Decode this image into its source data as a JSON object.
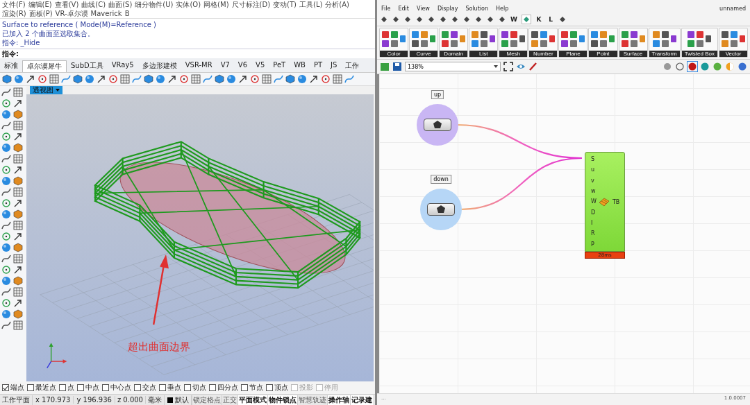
{
  "rhino": {
    "menu": [
      "文件(F)",
      "编辑(E)",
      "查看(V)",
      "曲线(C)",
      "曲面(S)",
      "细分物件(U)",
      "实体(O)",
      "网格(M)",
      "尺寸标注(D)",
      "变动(T)",
      "工具(L)",
      "分析(A)",
      "渲染(R)",
      "面板(P)",
      "VR-卓尔谟",
      "Maverick",
      "B"
    ],
    "command_history": [
      "Surface to reference ( Mode(M)=Reference )",
      "已加入 2 个曲面至选取集合。",
      "指令: _Hide"
    ],
    "command_prompt": "指令:",
    "tabs": [
      {
        "label": "标准",
        "selected": false
      },
      {
        "label": "卓尔谟犀牛",
        "selected": true
      },
      {
        "label": "SubD工具",
        "selected": false
      },
      {
        "label": "VRay5",
        "selected": false
      },
      {
        "label": "多边形建模",
        "selected": false
      },
      {
        "label": "VSR-MR",
        "selected": false
      },
      {
        "label": "V7",
        "selected": false
      },
      {
        "label": "V6",
        "selected": false
      },
      {
        "label": "V5",
        "selected": false
      },
      {
        "label": "PeT",
        "selected": false
      },
      {
        "label": "WB",
        "selected": false
      },
      {
        "label": "PT",
        "selected": false
      },
      {
        "label": "JS",
        "selected": false
      },
      {
        "label": "工作",
        "selected": false
      }
    ],
    "viewport": {
      "title": "透视图",
      "annotation": "超出曲面边界"
    },
    "osnaps": [
      {
        "label": "端点",
        "checked": true,
        "disabled": false
      },
      {
        "label": "最近点",
        "checked": false,
        "disabled": false
      },
      {
        "label": "点",
        "checked": false,
        "disabled": false
      },
      {
        "label": "中点",
        "checked": false,
        "disabled": false
      },
      {
        "label": "中心点",
        "checked": false,
        "disabled": false
      },
      {
        "label": "交点",
        "checked": false,
        "disabled": false
      },
      {
        "label": "垂点",
        "checked": false,
        "disabled": false
      },
      {
        "label": "切点",
        "checked": false,
        "disabled": false
      },
      {
        "label": "四分点",
        "checked": false,
        "disabled": false
      },
      {
        "label": "节点",
        "checked": false,
        "disabled": false
      },
      {
        "label": "顶点",
        "checked": false,
        "disabled": false
      },
      {
        "label": "投影",
        "checked": false,
        "disabled": true
      },
      {
        "label": "停用",
        "checked": false,
        "disabled": true
      }
    ],
    "status": {
      "cplane": "工作平面",
      "x": "x 170.973",
      "y": "y 196.936",
      "z": "z 0.000",
      "units": "毫米",
      "layer": "默认",
      "toggles": [
        {
          "label": "锁定格点",
          "on": false
        },
        {
          "label": "正交",
          "on": false
        },
        {
          "label": "平面模式",
          "on": true
        },
        {
          "label": "物件锁点",
          "on": true
        },
        {
          "label": "智慧轨迹",
          "on": false
        },
        {
          "label": "操作轴",
          "on": true
        },
        {
          "label": "记录建",
          "on": true
        }
      ]
    }
  },
  "grasshopper": {
    "menu": [
      "File",
      "Edit",
      "View",
      "Display",
      "Solution",
      "Help"
    ],
    "document": "unnamed",
    "tabs": [
      {
        "kind": "icon",
        "selected": false
      },
      {
        "kind": "icon",
        "selected": false
      },
      {
        "kind": "icon",
        "selected": false
      },
      {
        "kind": "icon",
        "selected": false
      },
      {
        "kind": "icon",
        "selected": false
      },
      {
        "kind": "icon",
        "selected": false
      },
      {
        "kind": "icon",
        "selected": false
      },
      {
        "kind": "icon",
        "selected": false
      },
      {
        "kind": "icon",
        "selected": false
      },
      {
        "kind": "icon",
        "selected": false
      },
      {
        "kind": "icon",
        "selected": false
      },
      {
        "kind": "letter",
        "label": "W",
        "selected": false
      },
      {
        "kind": "icon",
        "selected": true
      },
      {
        "kind": "letter",
        "label": "K",
        "selected": false
      },
      {
        "kind": "letter",
        "label": "L",
        "selected": false
      },
      {
        "kind": "icon",
        "selected": false
      }
    ],
    "ribbon_groups": [
      "Color",
      "Curve",
      "Domain",
      "List",
      "Mesh",
      "Number",
      "Plane",
      "Point",
      "Surface",
      "Transform",
      "Twisted Box",
      "Vector"
    ],
    "zoom": "138%",
    "canvas": {
      "params": [
        {
          "label": "up",
          "color": "#c9b6f4"
        },
        {
          "label": "down",
          "color": "#b6d6f6"
        }
      ],
      "component": {
        "inputs": [
          "S",
          "u",
          "v",
          "w",
          "W",
          "D",
          "I",
          "R",
          "P"
        ],
        "output": "TB",
        "timing": "28ms"
      }
    },
    "status": {
      "left": "...",
      "version": "1.0.0007"
    }
  }
}
